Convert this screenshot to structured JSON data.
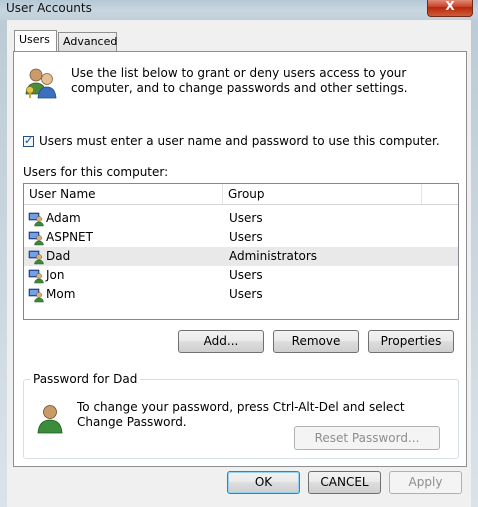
{
  "window": {
    "title": "User Accounts",
    "close_label": "X"
  },
  "tabs": [
    {
      "label": "Users",
      "active": true
    },
    {
      "label": "Advanced",
      "active": false
    }
  ],
  "intro_text": "Use the list below to grant or deny users access to your computer, and to change passwords and other settings.",
  "require_login": {
    "label": "Users must enter a user name and password to use this computer.",
    "checked": true,
    "check_glyph": "✓"
  },
  "users_section_label": "Users for this computer:",
  "user_list": {
    "columns": [
      "User Name",
      "Group"
    ],
    "rows": [
      {
        "name": "Adam",
        "group": "Users"
      },
      {
        "name": "ASPNET",
        "group": "Users"
      },
      {
        "name": "Dad",
        "group": "Administrators"
      },
      {
        "name": "Jon",
        "group": "Users"
      },
      {
        "name": "Mom",
        "group": "Users"
      }
    ],
    "selected_index": 2
  },
  "list_buttons": {
    "add": "Add...",
    "remove": "Remove",
    "properties": "Properties"
  },
  "password_group": {
    "legend": "Password for Dad",
    "text": "To change your password, press Ctrl-Alt-Del and select Change Password.",
    "reset_button": "Reset Password..."
  },
  "dialog_buttons": {
    "ok": "OK",
    "cancel": "CANCEL",
    "apply": "Apply"
  },
  "colors": {
    "accent": "#3c7fb1",
    "selection": "#e9e9e9",
    "close": "#c8432a"
  }
}
